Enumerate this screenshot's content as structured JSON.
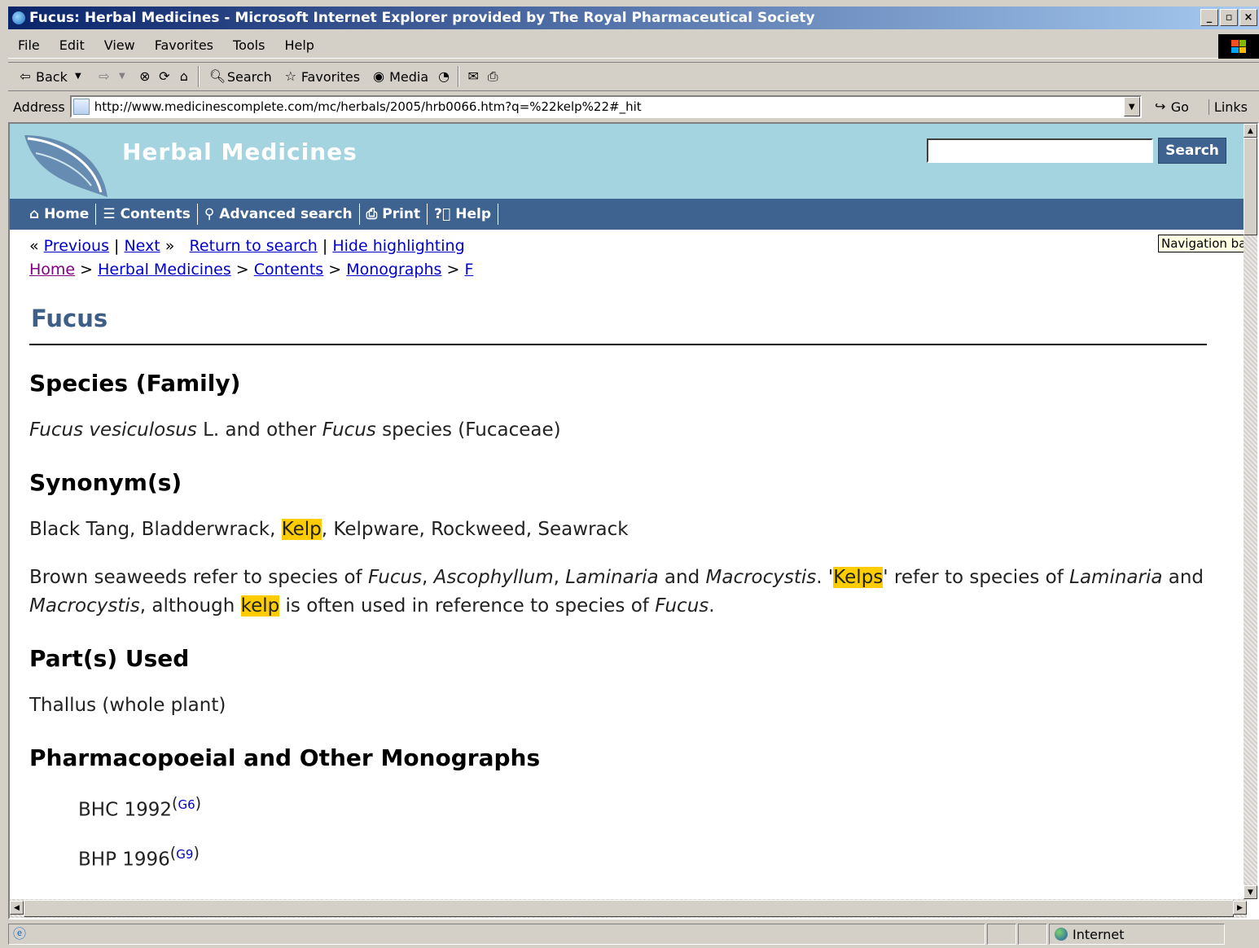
{
  "window": {
    "title": "Fucus: Herbal Medicines - Microsoft Internet Explorer provided by The Royal Pharmaceutical Society",
    "minimize": "_",
    "maximize": "▫",
    "close": "×"
  },
  "menu": [
    "File",
    "Edit",
    "View",
    "Favorites",
    "Tools",
    "Help"
  ],
  "toolbar": {
    "back": "Back",
    "search": "Search",
    "favorites": "Favorites",
    "media": "Media"
  },
  "address": {
    "label": "Address",
    "url": "http://www.medicinescomplete.com/mc/herbals/2005/hrb0066.htm?q=%22kelp%22#_hit",
    "go": "Go",
    "links": "Links"
  },
  "site": {
    "title": "Herbal Medicines",
    "search_button": "Search",
    "search_value": "",
    "nav": [
      "Home",
      "Contents",
      "Advanced search",
      "Print",
      "Help"
    ]
  },
  "tooltip": "Navigation bar",
  "pager": {
    "previous": "Previous",
    "next": "Next",
    "return_to_search": "Return to search",
    "hide_highlighting": "Hide highlighting"
  },
  "breadcrumb": [
    "Home",
    "Herbal Medicines",
    "Contents",
    "Monographs",
    "F"
  ],
  "page": {
    "title": "Fucus",
    "sections": {
      "species_heading": "Species (Family)",
      "species_text_italic1": "Fucus vesiculosus",
      "species_text_mid": " L. and other ",
      "species_text_italic2": "Fucus",
      "species_text_end": " species (Fucaceae)",
      "synonyms_heading": "Synonym(s)",
      "synonyms_before": "Black Tang, Bladderwrack, ",
      "synonyms_hl": "Kelp",
      "synonyms_after": ", Kelpware, Rockweed, Seawrack",
      "parts_heading": "Part(s) Used",
      "parts_text": "Thallus (whole plant)",
      "mono_heading": "Pharmacopoeial and Other Monographs",
      "mono_1": "BHC 1992",
      "mono_1_ref": "G6",
      "mono_2": "BHP 1996",
      "mono_2_ref": "G9"
    }
  },
  "status": {
    "zone": "Internet"
  }
}
